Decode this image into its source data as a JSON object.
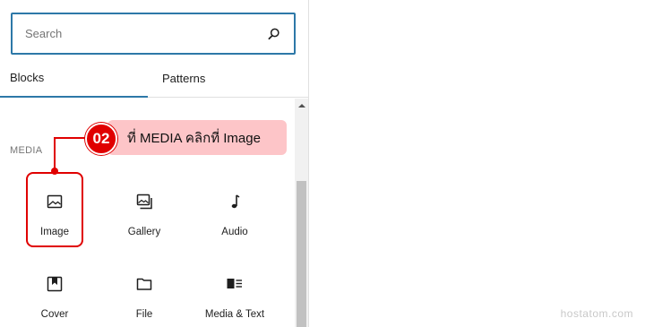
{
  "search": {
    "placeholder": "Search",
    "icon": "search-icon"
  },
  "tabs": [
    {
      "label": "Blocks",
      "active": true
    },
    {
      "label": "Patterns",
      "active": false
    }
  ],
  "category": "MEDIA",
  "blocks": [
    {
      "label": "Image",
      "icon": "image-icon"
    },
    {
      "label": "Gallery",
      "icon": "gallery-icon"
    },
    {
      "label": "Audio",
      "icon": "audio-icon"
    },
    {
      "label": "Cover",
      "icon": "cover-icon"
    },
    {
      "label": "File",
      "icon": "file-icon"
    },
    {
      "label": "Media & Text",
      "icon": "media-text-icon"
    }
  ],
  "annotation": {
    "step": "02",
    "text": "ที่ MEDIA คลิกที่ Image",
    "color": "#e00000",
    "background": "#fdc5c8"
  },
  "watermark": "hostatom.com",
  "colors": {
    "accent": "#2d78a8",
    "text": "#1e1e1e",
    "muted": "#757575"
  }
}
